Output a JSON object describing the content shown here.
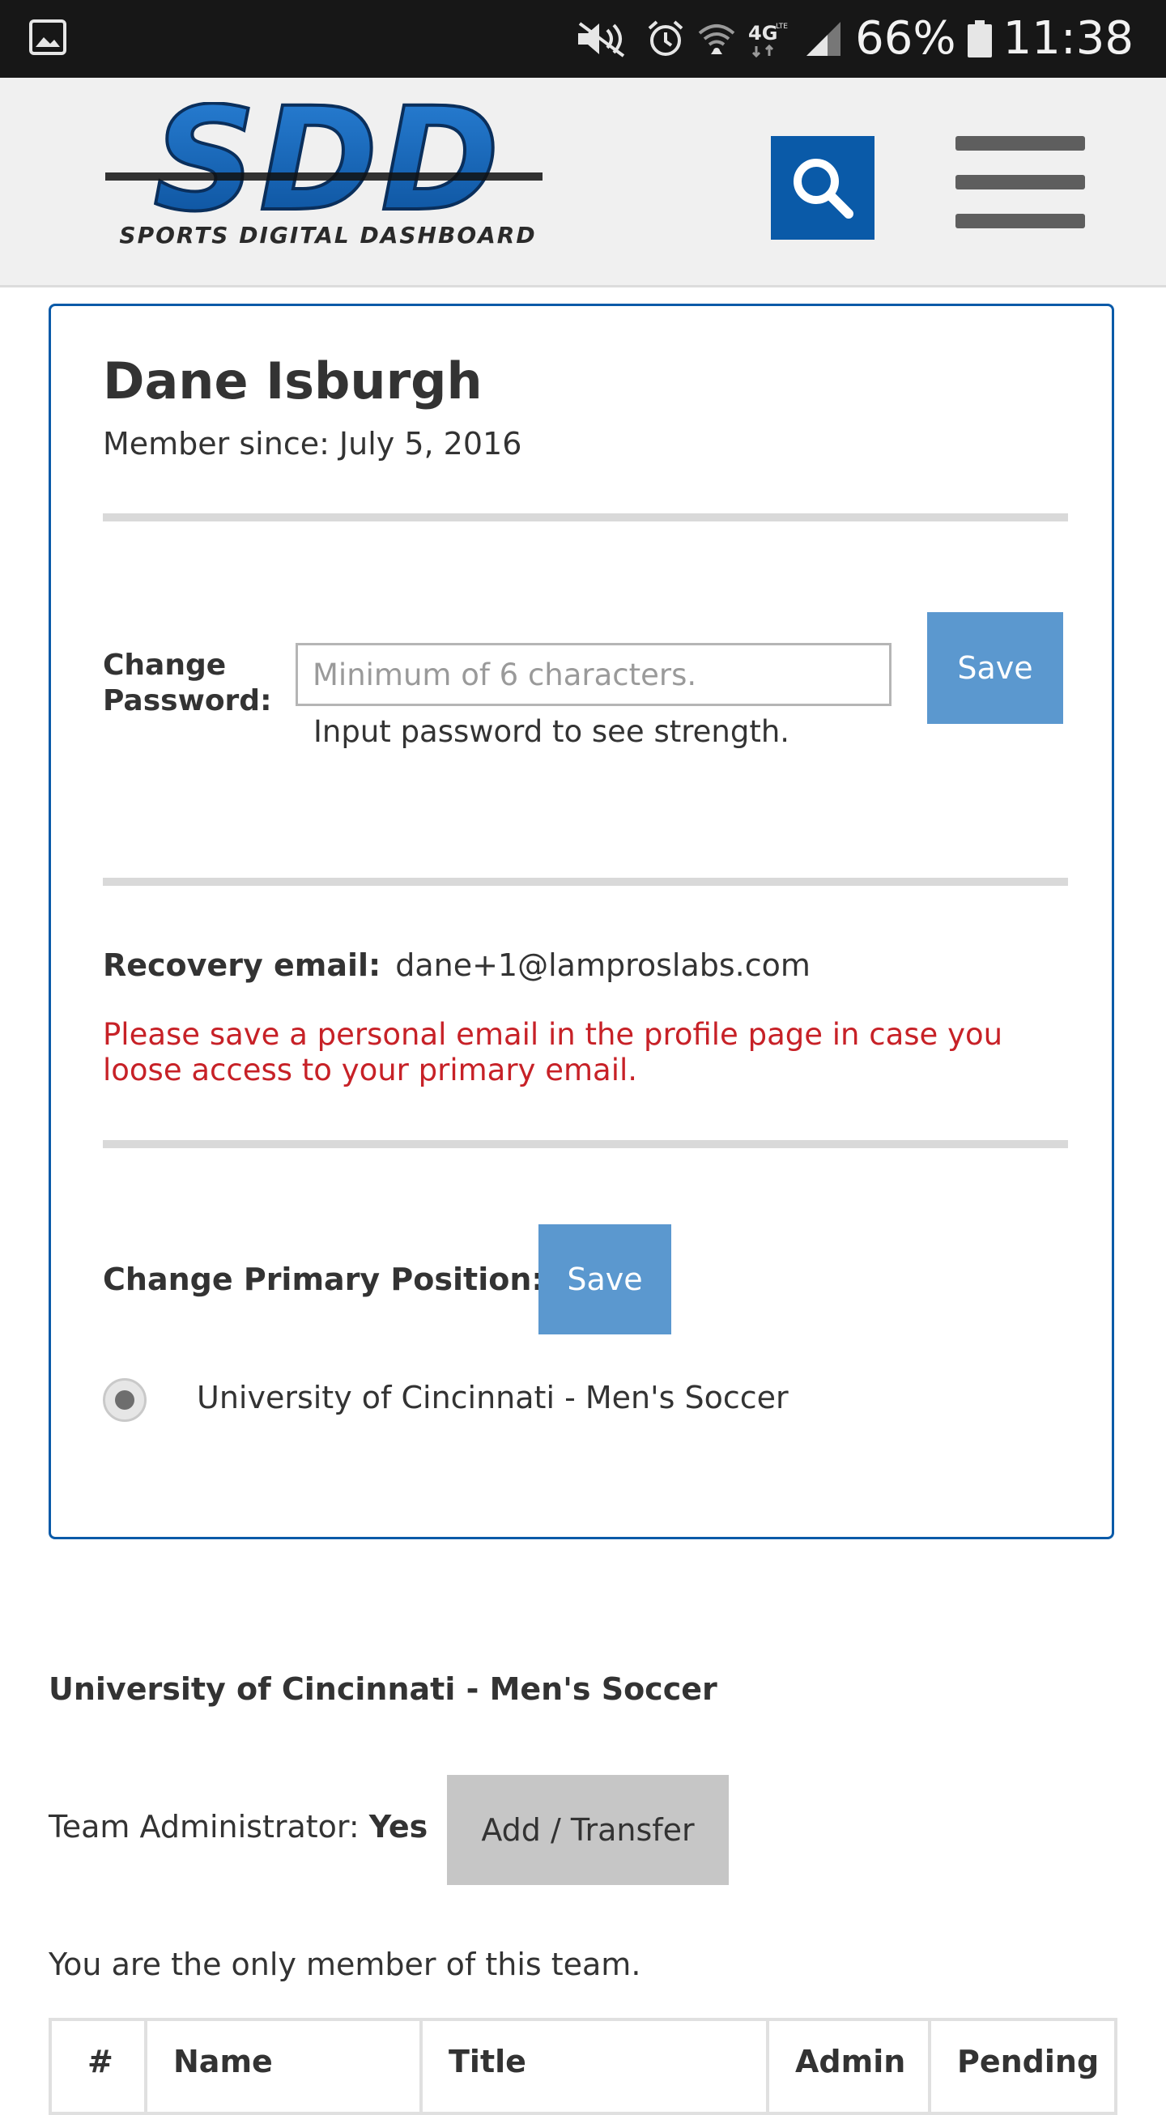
{
  "status_bar": {
    "icons": [
      "gallery-icon",
      "mute-icon",
      "alarm-icon",
      "wifi-icon",
      "4g-lte-icon",
      "signal-icon",
      "battery-icon"
    ],
    "battery": "66%",
    "time": "11:38"
  },
  "header": {
    "logo_text": "SDD",
    "logo_tagline": "SPORTS DIGITAL DASHBOARD",
    "brand_color": "#0a5aa8"
  },
  "profile": {
    "name": "Dane Isburgh",
    "member_since_label": "Member since:",
    "member_since_value": "July 5, 2016",
    "change_password": {
      "label_line1": "Change",
      "label_line2": "Password:",
      "placeholder": "Minimum of 6 characters.",
      "value": "",
      "hint": "Input password to see strength.",
      "save_label": "Save"
    },
    "recovery": {
      "label": "Recovery email:",
      "email": "dane+1@lamproslabs.com",
      "warning": "Please save a personal email in the profile page in case you loose access to your primary email.",
      "warning_color": "#c72127"
    },
    "primary_position": {
      "label": "Change Primary Position:",
      "save_label": "Save",
      "options": [
        {
          "label": "University of Cincinnati - Men's Soccer",
          "selected": true
        }
      ]
    }
  },
  "team": {
    "name": "University of Cincinnati - Men's Soccer",
    "admin_label": "Team Administrator:",
    "admin_value": "Yes",
    "add_transfer_label": "Add / Transfer",
    "only_member_text": "You are the only member of this team.",
    "table_headers": [
      "#",
      "Name",
      "Title",
      "Admin",
      "Pending"
    ]
  },
  "colors": {
    "button_blue": "#5b98cf",
    "button_gray": "#c6c6c6",
    "card_border": "#0a5aa8"
  }
}
